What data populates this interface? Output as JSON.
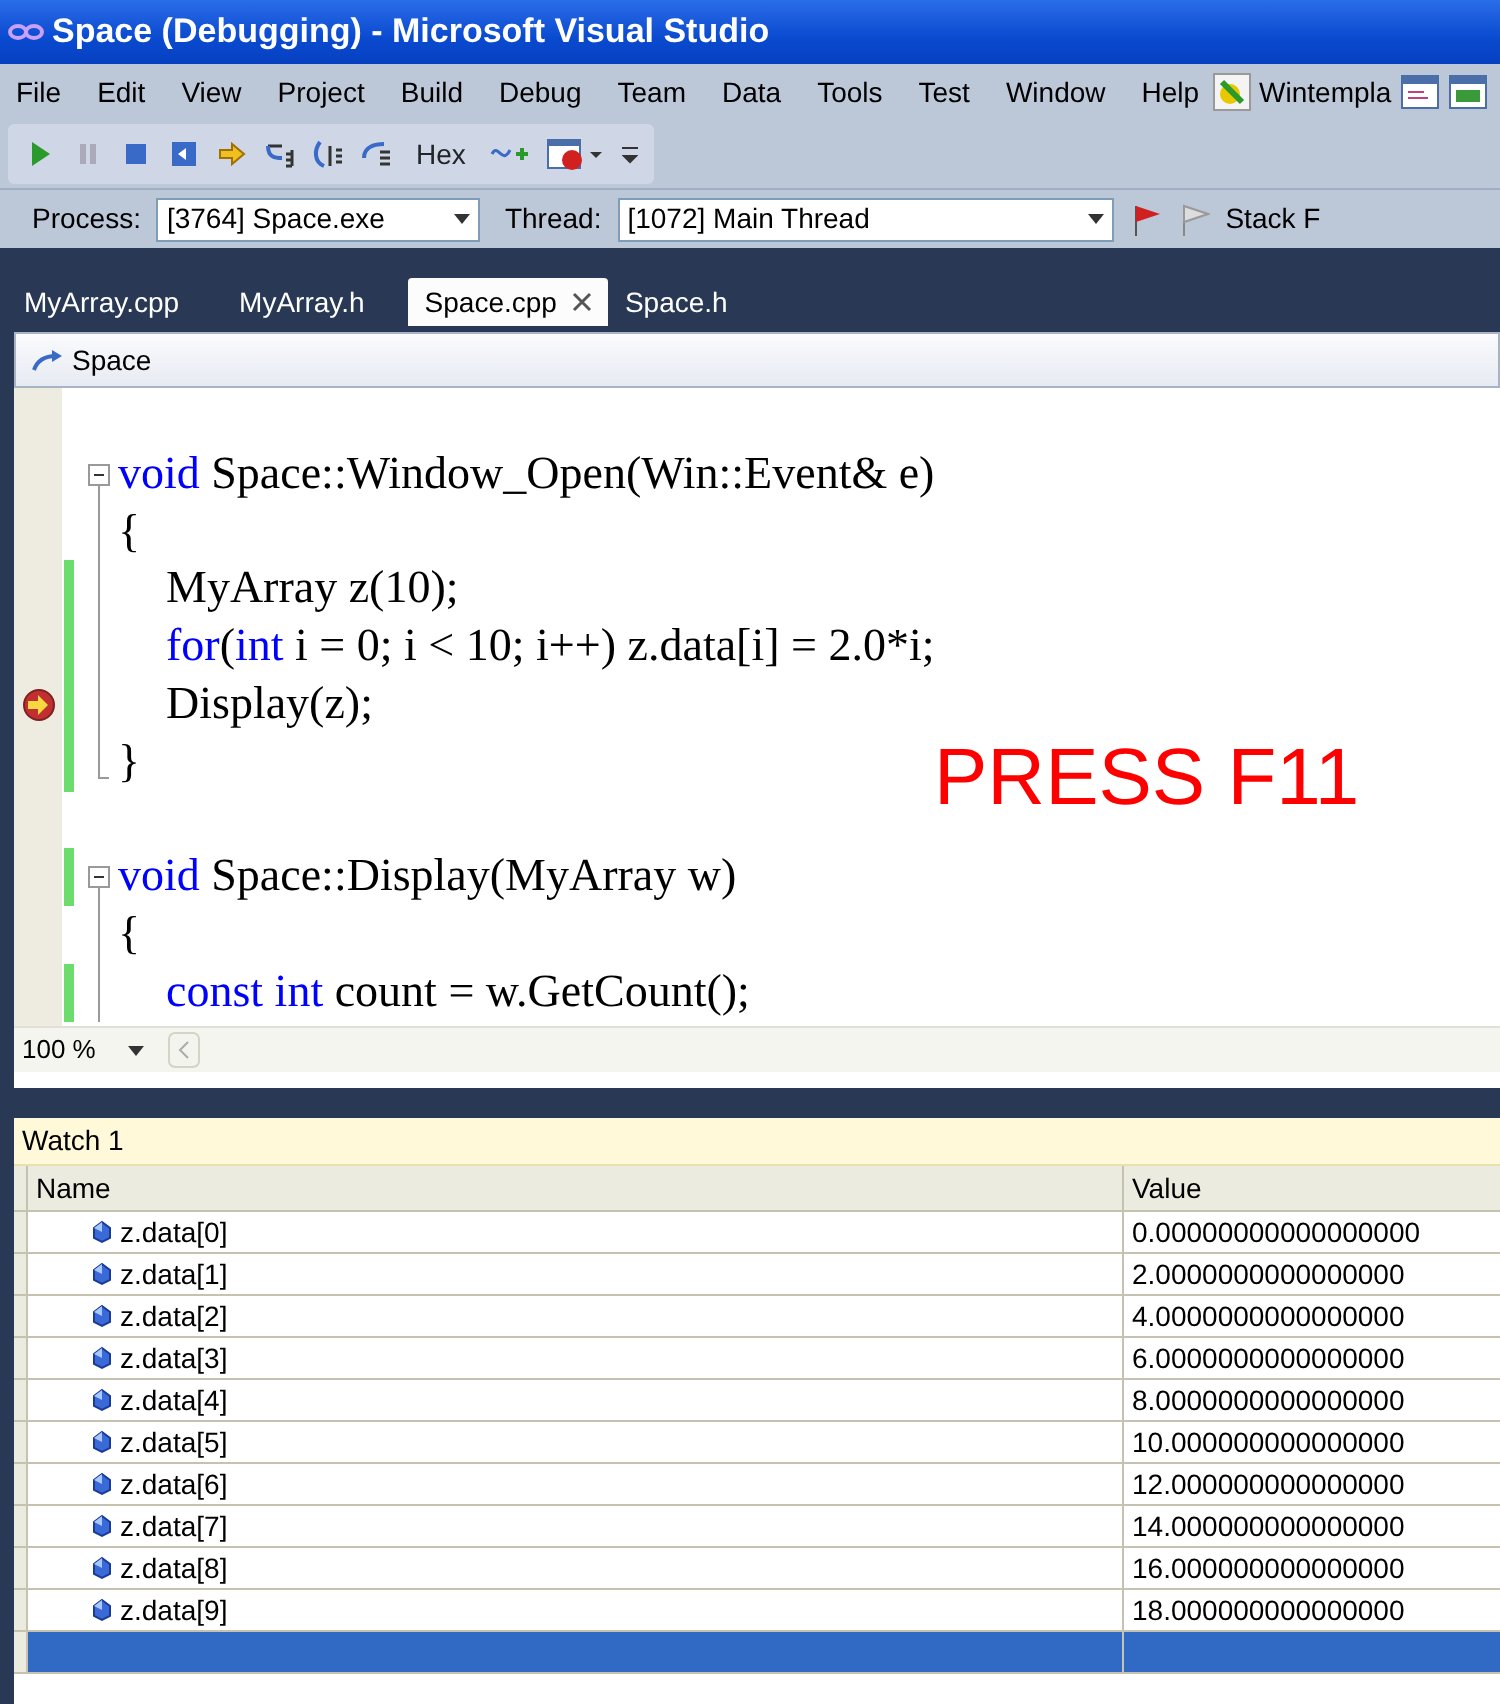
{
  "window": {
    "title": "Space (Debugging) - Microsoft Visual Studio"
  },
  "menu": {
    "items": [
      "File",
      "Edit",
      "View",
      "Project",
      "Build",
      "Debug",
      "Team",
      "Data",
      "Tools",
      "Test",
      "Window",
      "Help"
    ],
    "addin": "Wintempla"
  },
  "toolbar": {
    "hex": {
      "label": "Hex",
      "on": false
    }
  },
  "debug_location": {
    "process_label": "Process:",
    "process": "[3764] Space.exe",
    "thread_label": "Thread:",
    "thread": "[1072] Main Thread",
    "stack_label": "Stack F"
  },
  "tabs": [
    {
      "label": "MyArray.cpp",
      "selected": false
    },
    {
      "label": "MyArray.h",
      "selected": false
    },
    {
      "label": "Space.cpp",
      "selected": true
    },
    {
      "label": "Space.h",
      "selected": false
    }
  ],
  "editor": {
    "navigation": "Space",
    "zoom": "100 %",
    "overlay": "PRESS F11",
    "lines": [
      {
        "kind": "blank"
      },
      {
        "kind": "signature",
        "changed": false,
        "current": false,
        "tokens": [
          {
            "text": "void",
            "keyword": true
          },
          {
            "text": " Space::Window_Open(Win::Event& e)",
            "keyword": false
          }
        ]
      },
      {
        "kind": "brace",
        "changed": false,
        "current": false,
        "tokens": [
          {
            "text": "{",
            "keyword": false
          }
        ]
      },
      {
        "kind": "statement",
        "changed": true,
        "current": false,
        "tokens": [
          {
            "text": "MyArray z(10);",
            "keyword": false
          }
        ]
      },
      {
        "kind": "statement",
        "changed": true,
        "current": false,
        "tokens": [
          {
            "text": "for",
            "keyword": true
          },
          {
            "text": "(",
            "keyword": false
          },
          {
            "text": "int",
            "keyword": true
          },
          {
            "text": " i = 0; i < 10; i++) z.data[i] = 2.0*i;",
            "keyword": false
          }
        ]
      },
      {
        "kind": "statement",
        "changed": true,
        "current": true,
        "tokens": [
          {
            "text": "Display(z);",
            "keyword": false
          }
        ]
      },
      {
        "kind": "end",
        "changed": true,
        "current": false,
        "tokens": [
          {
            "text": "}",
            "keyword": false
          }
        ]
      },
      {
        "kind": "blank"
      },
      {
        "kind": "signature",
        "changed": true,
        "current": false,
        "tokens": [
          {
            "text": "void",
            "keyword": true
          },
          {
            "text": " Space::Display(MyArray w)",
            "keyword": false
          }
        ]
      },
      {
        "kind": "brace",
        "changed": false,
        "current": false,
        "tokens": [
          {
            "text": "{",
            "keyword": false
          }
        ]
      },
      {
        "kind": "statement",
        "changed": true,
        "current": false,
        "tokens": [
          {
            "text": "const int",
            "keyword": true
          },
          {
            "text": " count = w.GetCount();",
            "keyword": false
          }
        ]
      }
    ]
  },
  "watch": {
    "title": "Watch 1",
    "columns": [
      "Name",
      "Value"
    ],
    "rows": [
      {
        "name": "z.data[0]",
        "value": "0.00000000000000000",
        "selected": false
      },
      {
        "name": "z.data[1]",
        "value": "2.0000000000000000",
        "selected": false
      },
      {
        "name": "z.data[2]",
        "value": "4.0000000000000000",
        "selected": false
      },
      {
        "name": "z.data[3]",
        "value": "6.0000000000000000",
        "selected": false
      },
      {
        "name": "z.data[4]",
        "value": "8.0000000000000000",
        "selected": false
      },
      {
        "name": "z.data[5]",
        "value": "10.000000000000000",
        "selected": false
      },
      {
        "name": "z.data[6]",
        "value": "12.000000000000000",
        "selected": false
      },
      {
        "name": "z.data[7]",
        "value": "14.000000000000000",
        "selected": false
      },
      {
        "name": "z.data[8]",
        "value": "16.000000000000000",
        "selected": false
      },
      {
        "name": "z.data[9]",
        "value": "18.000000000000000",
        "selected": false
      }
    ],
    "new_row": {
      "selected": true
    }
  }
}
